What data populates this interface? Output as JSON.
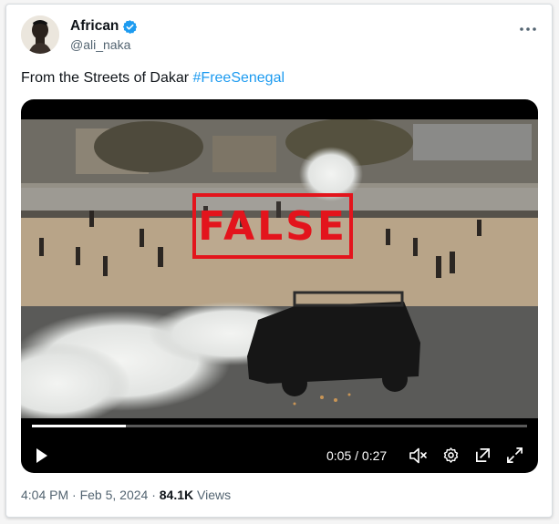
{
  "post": {
    "author_name": "African",
    "author_handle": "@ali_naka",
    "text": "From the Streets of Dakar ",
    "hashtag": "#FreeSenegal",
    "stamp": "FALSE",
    "timestamp": "4:04 PM · Feb 5, 2024 · ",
    "views_count": "84.1K",
    "views_label": " Views"
  },
  "player": {
    "time": "0:05 / 0:27",
    "progress": 0.19
  },
  "icons": {
    "verified": "verified-badge-icon",
    "more": "more-options-icon",
    "play": "play-icon",
    "mute": "volume-muted-icon",
    "settings": "settings-gear-icon",
    "popout": "popout-icon",
    "fullscreen": "fullscreen-icon"
  },
  "colors": {
    "accent": "#1d9bf0",
    "stamp_red": "#e3141c"
  }
}
